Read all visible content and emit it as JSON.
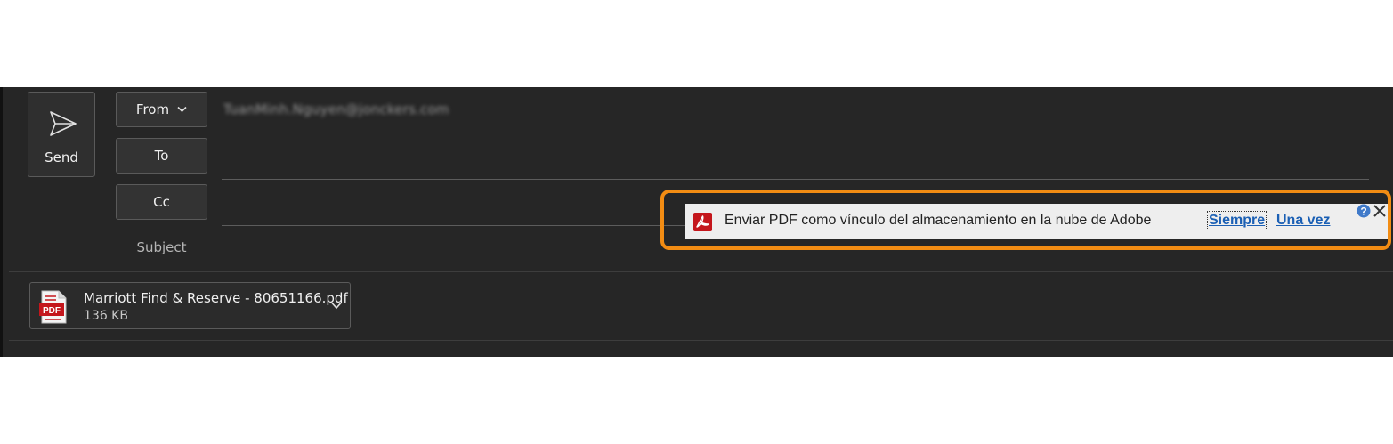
{
  "compose": {
    "send_label": "Send",
    "from_label": "From",
    "to_label": "To",
    "cc_label": "Cc",
    "subject_label": "Subject",
    "from_value": "TuanMinh.Nguyen@jonckers.com",
    "to_value": "",
    "cc_value": "",
    "subject_value": ""
  },
  "attachment": {
    "file_name": "Marriott Find & Reserve - 80651166.pdf",
    "file_size": "136 KB",
    "icon": "pdf-file-icon",
    "icon_text": "PDF"
  },
  "adobe_bar": {
    "message": "Enviar PDF como vínculo del almacenamiento en la nube de Adobe",
    "always_label": "Siempre",
    "once_label": "Una vez",
    "help_icon": "help-icon",
    "close_icon": "close-icon"
  },
  "colors": {
    "background": "#262626",
    "highlight_border": "#f28c13",
    "adobe_red": "#c4161c",
    "link_blue": "#1a5fb4"
  }
}
